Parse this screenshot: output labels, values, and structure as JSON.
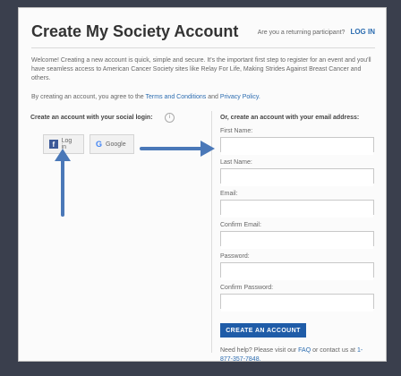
{
  "header": {
    "title": "Create My Society Account",
    "returning_text": "Are you a returning participant?",
    "login_label": "LOG IN"
  },
  "intro": {
    "welcome": "Welcome! Creating a new account is quick, simple and secure. It's the important first step to register for an event and you'll have seamless access to American Cancer Society sites like Relay For Life, Making Strides Against Breast Cancer and others.",
    "agree_prefix": "By creating an account, you agree to the",
    "terms_label": "Terms and Conditions",
    "agree_and": "and",
    "privacy_label": "Privacy Policy."
  },
  "social": {
    "label": "Create an account with your social login:",
    "info_glyph": "i",
    "facebook_label": "Log in",
    "google_label": "Google"
  },
  "email_form": {
    "label": "Or, create an account with your email address:",
    "fields": [
      {
        "label": "First Name:",
        "value": ""
      },
      {
        "label": "Last Name:",
        "value": ""
      },
      {
        "label": "Email:",
        "value": ""
      },
      {
        "label": "Confirm Email:",
        "value": ""
      },
      {
        "label": "Password:",
        "value": ""
      },
      {
        "label": "Confirm Password:",
        "value": ""
      }
    ],
    "create_label": "CREATE AN ACCOUNT",
    "help_prefix": "Need help? Please visit our",
    "faq_label": "FAQ",
    "help_middle": "or contact us at",
    "phone": "1-877-357-7848."
  },
  "icons": {
    "facebook": "facebook-icon",
    "google": "google-icon",
    "info": "info-icon",
    "arrow_up": "arrow-up-icon",
    "arrow_right": "arrow-right-icon"
  },
  "colors": {
    "accent": "#1f5ca8",
    "link": "#2b6cb0",
    "arrow": "#4a78b8",
    "facebook": "#3b5998"
  }
}
